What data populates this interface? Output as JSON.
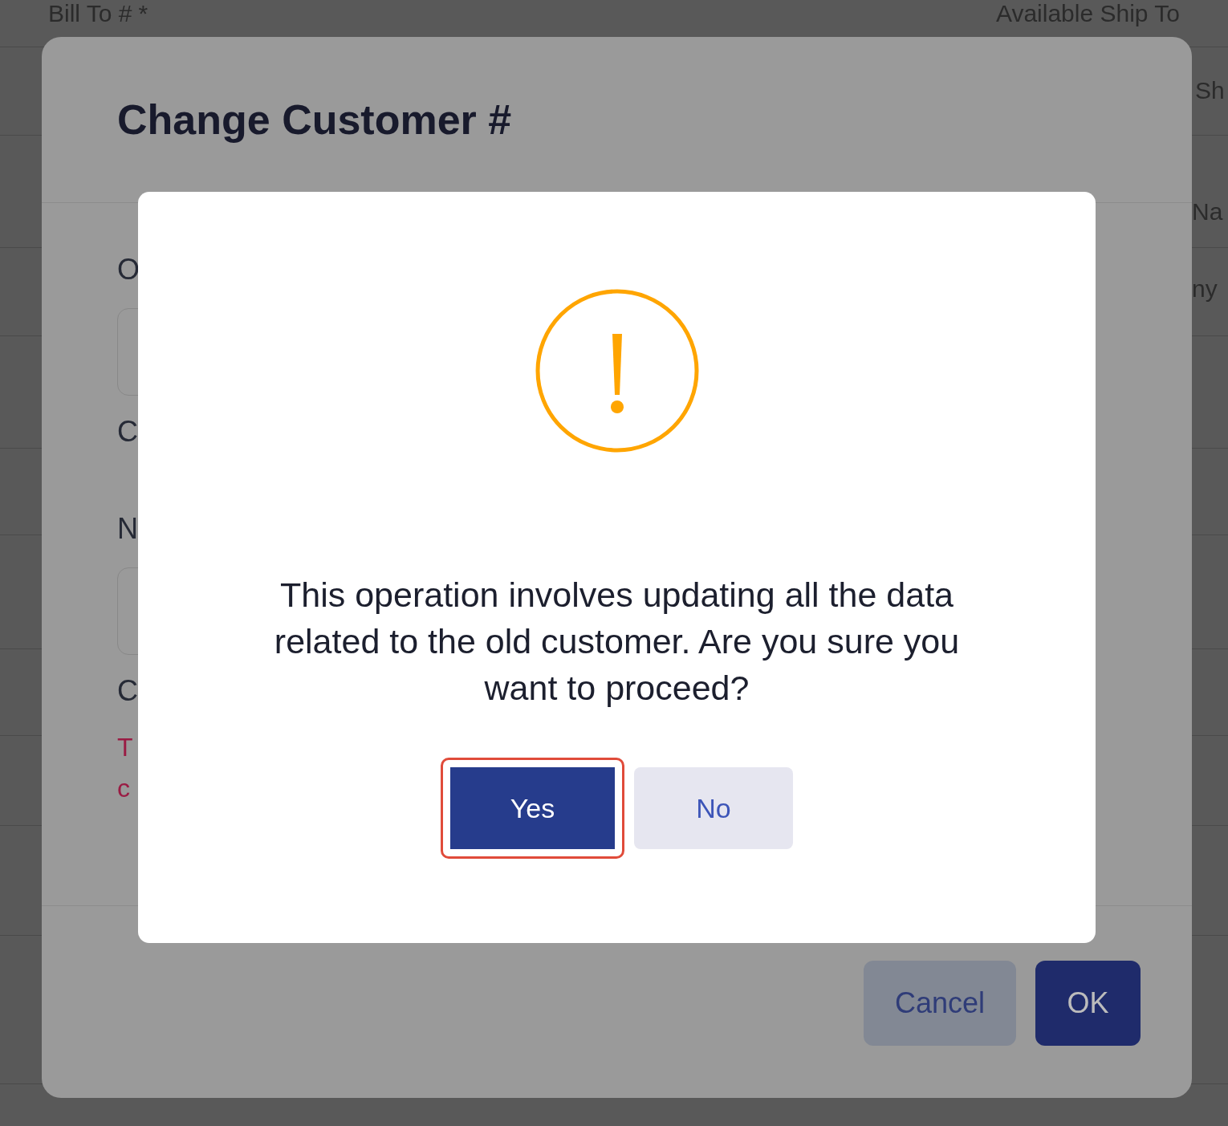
{
  "background_page": {
    "bill_to_label": "Bill To #",
    "required_mark": "*",
    "available_ship_to_label": "Available Ship To",
    "ship_to_fragments": [
      "Sh",
      "Na",
      "ny"
    ]
  },
  "change_customer_dialog": {
    "title": "Change Customer #",
    "body": [
      {
        "kind": "label",
        "text": "O"
      },
      {
        "kind": "input"
      },
      {
        "kind": "label",
        "text": "C"
      },
      {
        "kind": "label",
        "text": "N"
      },
      {
        "kind": "input"
      },
      {
        "kind": "label",
        "text": "C"
      },
      {
        "kind": "error",
        "text": "T"
      },
      {
        "kind": "error",
        "text": "c"
      }
    ],
    "buttons": [
      {
        "label": "Cancel",
        "kind": "secondary"
      },
      {
        "label": "OK",
        "kind": "primary"
      }
    ]
  },
  "confirm_dialog": {
    "message": "This operation involves updating all the data related to the old customer. Are you sure you want to proceed?",
    "buttons": [
      {
        "label": "Yes",
        "kind": "primary",
        "focused": true
      },
      {
        "label": "No",
        "kind": "secondary",
        "focused": false
      }
    ]
  }
}
